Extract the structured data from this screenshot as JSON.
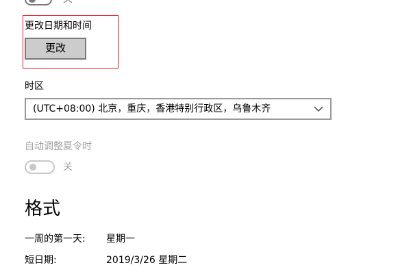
{
  "top_toggle": {
    "state_label": "关"
  },
  "date_time": {
    "label": "更改日期和时间",
    "button_label": "更改"
  },
  "timezone": {
    "label": "时区",
    "selected": "(UTC+08:00) 北京，重庆，香港特别行政区，乌鲁木齐"
  },
  "dst": {
    "label": "自动调整夏令时",
    "state_label": "关",
    "enabled": false
  },
  "formats": {
    "heading": "格式",
    "rows": [
      {
        "key": "一周的第一天:",
        "value": "星期一"
      },
      {
        "key": "短日期:",
        "value": "2019/3/26 星期二"
      }
    ]
  },
  "colors": {
    "focus_outline": "#e81123",
    "button_bg": "#cccccc",
    "disabled_text": "#a0a0a0"
  }
}
